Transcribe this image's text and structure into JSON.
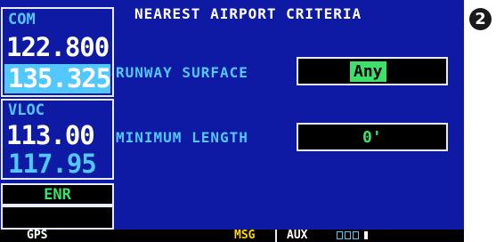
{
  "com": {
    "label": "COM",
    "active": "122.800",
    "standby": "135.325"
  },
  "vloc": {
    "label": "VLOC",
    "active": "113.00",
    "standby": "117.95"
  },
  "cdi": {
    "mode": "ENR"
  },
  "page": {
    "title": "NEAREST AIRPORT CRITERIA",
    "runway_surface_label": "RUNWAY SURFACE",
    "runway_surface_value": "Any",
    "minimum_length_label": "MINIMUM LENGTH",
    "minimum_length_value": "0'"
  },
  "status_bar": {
    "gps": "GPS",
    "msg": "MSG",
    "aux": "AUX",
    "page_count": 4,
    "active_page": 4
  },
  "callout": "2",
  "colors": {
    "background": "#0e1aa4",
    "cyan": "#52c8ff",
    "green": "#3ee06a",
    "yellow": "#ffd400"
  }
}
